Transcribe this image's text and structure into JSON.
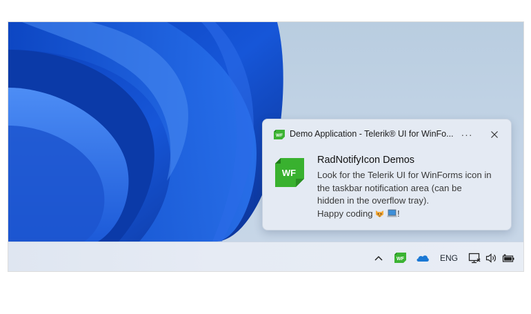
{
  "toast": {
    "app_title": "Demo Application - Telerik® UI for WinFo...",
    "more_label": "···",
    "heading": "RadNotifyIcon Demos",
    "body_lines": [
      "Look for the Telerik UI for WinForms icon in",
      "the taskbar notification area (can be",
      "hidden in the overflow tray)."
    ],
    "sign_off_prefix": "Happy coding ",
    "sign_off_suffix": "!",
    "app_icon_text": "WF",
    "accent_color": "#2fa52b"
  },
  "taskbar": {
    "language": "ENG",
    "tray_icons": [
      "chevron-up-icon",
      "winforms-app-icon",
      "onedrive-cloud-icon",
      "network-icon",
      "volume-icon",
      "battery-icon"
    ]
  }
}
